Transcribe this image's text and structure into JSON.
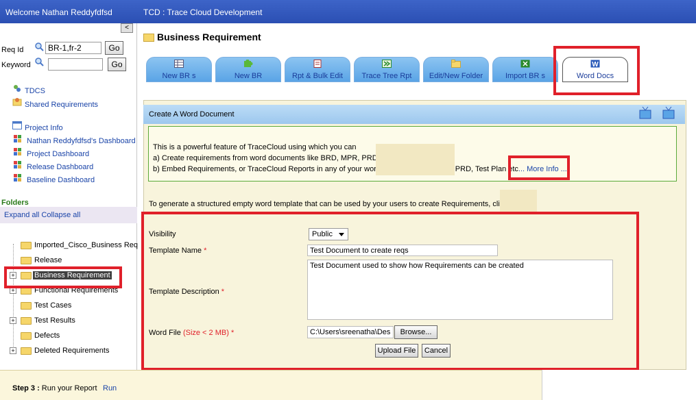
{
  "topbar": {
    "welcome": "Welcome Nathan Reddyfdfsd",
    "app_title": "TCD : Trace Cloud Development"
  },
  "sidebar": {
    "collapse_glyph": "<",
    "req_id_label": "Req Id",
    "req_id_value": "BR-1,fr-2",
    "keyword_label": "Keyword",
    "keyword_value": "",
    "go_label": "Go",
    "links": [
      {
        "label": "TDCS",
        "icon": "tdcs-icon"
      },
      {
        "label": "Shared Requirements",
        "icon": "shared-icon"
      },
      {
        "label": "Project Info",
        "icon": "info-icon"
      },
      {
        "label": "Nathan Reddyfdfsd's Dashboard",
        "icon": "dashboard-icon"
      },
      {
        "label": "Project Dashboard",
        "icon": "dashboard-icon"
      },
      {
        "label": "Release Dashboard",
        "icon": "dashboard-icon"
      },
      {
        "label": "Baseline Dashboard",
        "icon": "dashboard-icon"
      }
    ],
    "folders_title": "Folders",
    "expand_collapse": "Expand all Collapse all",
    "tree": [
      {
        "label": "Imported_Cisco_Business Req",
        "expandable": false
      },
      {
        "label": "Release",
        "expandable": false
      },
      {
        "label": "Business Requirement",
        "expandable": true,
        "selected": true
      },
      {
        "label": "Functional Requirements",
        "expandable": true
      },
      {
        "label": "Test Cases",
        "expandable": false
      },
      {
        "label": "Test Results",
        "expandable": true
      },
      {
        "label": "Defects",
        "expandable": false
      },
      {
        "label": "Deleted Requirements",
        "expandable": true
      }
    ]
  },
  "main": {
    "page_title": "Business Requirement",
    "tabs": [
      {
        "label": "New BR s",
        "icon": "table-icon"
      },
      {
        "label": "New BR",
        "icon": "puzzle-icon"
      },
      {
        "label": "Rpt & Bulk Edit",
        "icon": "report-icon"
      },
      {
        "label": "Trace Tree Rpt",
        "icon": "excel-tree-icon"
      },
      {
        "label": "Edit/New Folder",
        "icon": "folder-icon"
      },
      {
        "label": "Import BR s",
        "icon": "excel-icon"
      },
      {
        "label": "Word Docs",
        "icon": "word-icon",
        "active": true
      }
    ],
    "section_title": "Create A Word Document",
    "info_lines": [
      "This is a powerful feature of TraceCloud using which you can",
      "a) Create requirements from word documents like BRD, MPR, PRD e",
      "b) Embed Requirements, or TraceCloud Reports in any of your word documents like BRD, PRD, Test Plan etc"
    ],
    "more_info": "... More Info ...",
    "generate_text": "To generate a structured empty word template that can be used by your users to create Requirements, cli",
    "form": {
      "visibility_label": "Visibility",
      "visibility_value": "Public",
      "template_name_label": "Template Name",
      "template_name_value": "Test Document to create reqs",
      "template_desc_label": "Template Description",
      "template_desc_value": "Test Document used to show how Requirements can be created",
      "word_file_label": "Word File",
      "word_file_hint": "(Size < 2 MB)",
      "word_file_value": "C:\\Users\\sreenatha\\Des",
      "required_mark": "*",
      "browse_label": "Browse...",
      "upload_label": "Upload File",
      "cancel_label": "Cancel"
    }
  },
  "footer": {
    "step_label": "Step 3 :",
    "step_text": "Run your Report",
    "run_label": "Run"
  },
  "colors": {
    "topbar": "#2b4fb3",
    "highlight_red": "#e0202a",
    "tab_blue": "#5aa4e6",
    "pane_cream": "#f8f4dc"
  }
}
